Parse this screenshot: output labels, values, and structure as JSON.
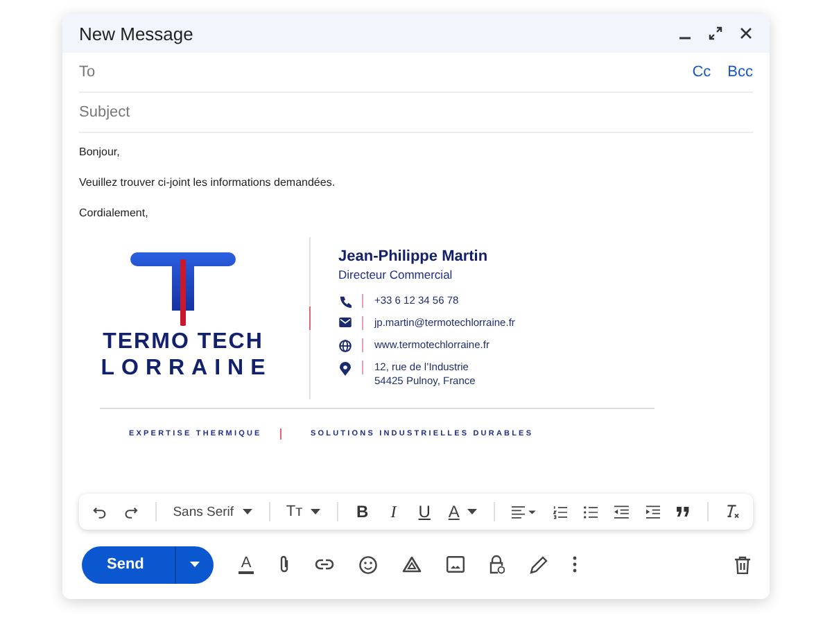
{
  "window": {
    "title": "New Message"
  },
  "to": {
    "placeholder": "To"
  },
  "cc": "Cc",
  "bcc": "Bcc",
  "subject": {
    "placeholder": "Subject"
  },
  "body": [
    "Bonjour,",
    "Veuillez trouver ci-joint les informations demandées.",
    "Cordialement,"
  ],
  "signature": {
    "logo_lines": [
      "TERMO TECH",
      "LORRAINE"
    ],
    "name": "Jean-Philippe Martin",
    "role": "Directeur Commercial",
    "contacts": [
      {
        "kind": "phone",
        "lines": [
          "+33 6 12 34 56 78"
        ]
      },
      {
        "kind": "email",
        "lines": [
          "jp.martin@termotechlorraine.fr"
        ]
      },
      {
        "kind": "web",
        "lines": [
          "www.termotechlorraine.fr"
        ]
      },
      {
        "kind": "address",
        "lines": [
          "12, rue de l’Industrie",
          "54425 Pulnoy, France"
        ]
      }
    ],
    "taglines": [
      "EXPERTISE THERMIQUE",
      "SOLUTIONS INDUSTRIELLES DURABLES"
    ]
  },
  "format_toolbar": {
    "font": "Sans Serif",
    "size": "Tт",
    "bold": "B",
    "italic": "I",
    "underline": "U",
    "text_color_glyph": "A"
  },
  "send_button": "Send",
  "text_color": "A"
}
